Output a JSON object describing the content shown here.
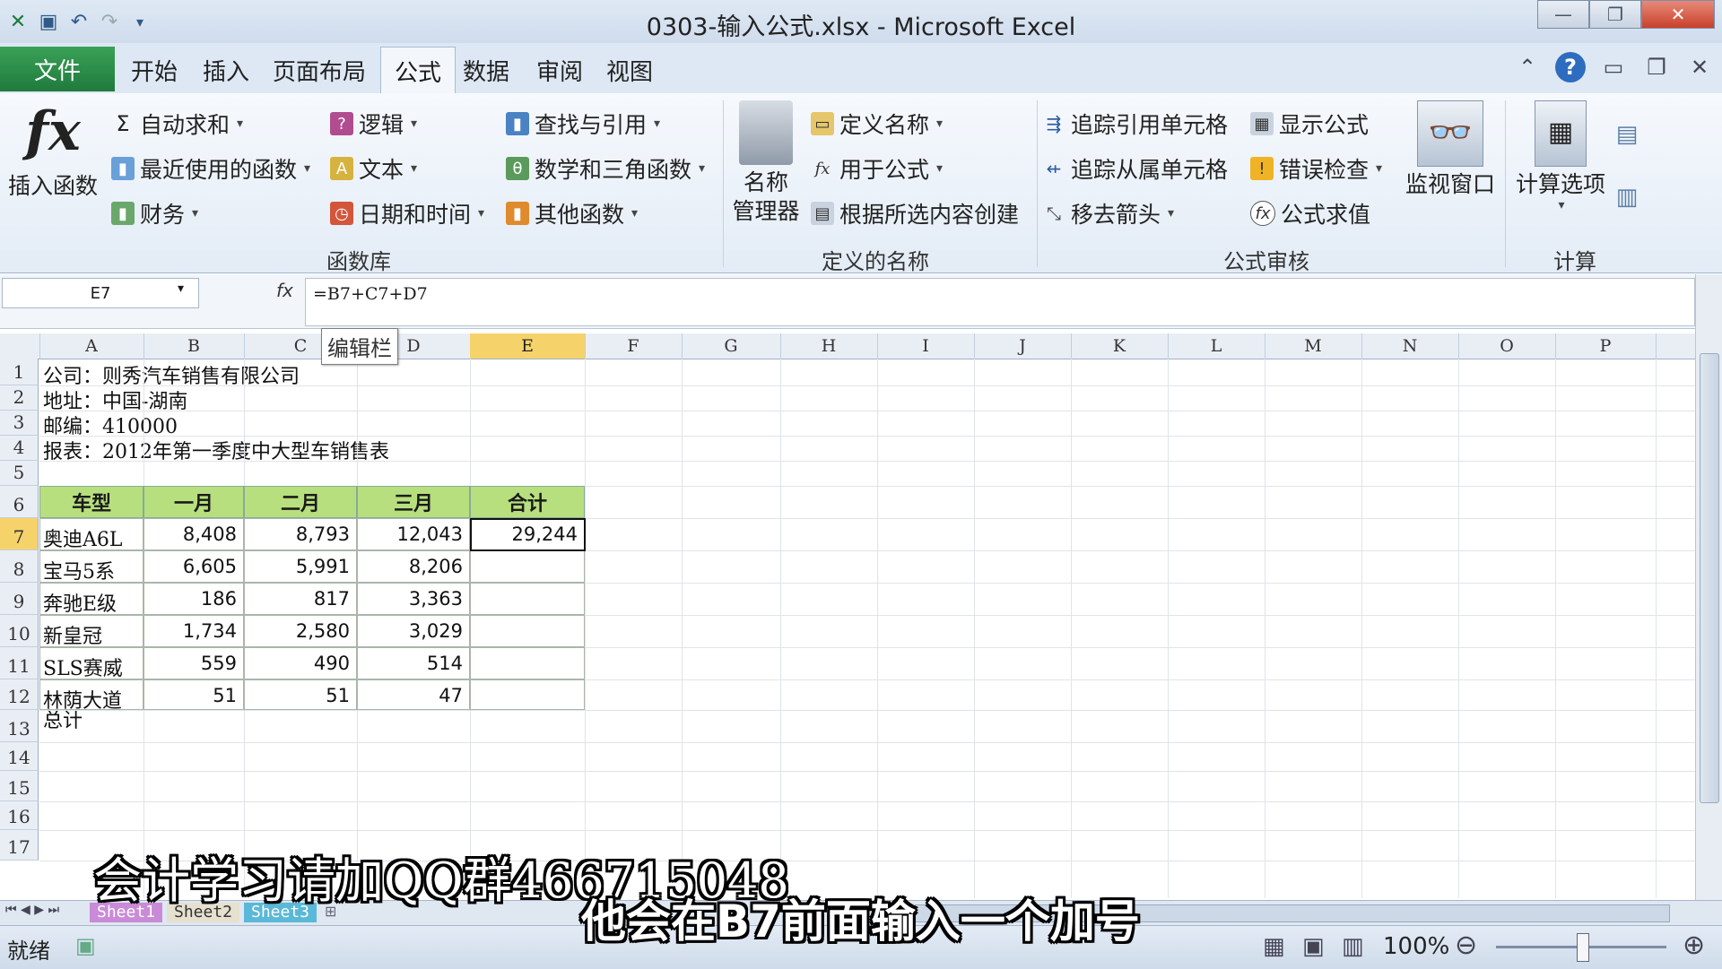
{
  "window": {
    "title": "0303-输入公式.xlsx - Microsoft Excel"
  },
  "tabs": [
    "开始",
    "插入",
    "页面布局",
    "数据",
    "审阅",
    "视图"
  ],
  "tab_file": "文件",
  "tab_active": "公式",
  "ribbon": {
    "insert_function": "插入函数",
    "autosum": "自动求和",
    "recent": "最近使用的函数",
    "finance": "财务",
    "logic": "逻辑",
    "text": "文本",
    "datetime": "日期和时间",
    "lookup": "查找与引用",
    "math": "数学和三角函数",
    "other": "其他函数",
    "group_library": "函数库",
    "name_manager_1": "名称",
    "name_manager_2": "管理器",
    "define_name": "定义名称",
    "use_in_formula": "用于公式",
    "create_from_sel": "根据所选内容创建",
    "group_names": "定义的名称",
    "trace_precedents": "追踪引用单元格",
    "trace_dependents": "追踪从属单元格",
    "remove_arrows": "移去箭头",
    "show_formulas": "显示公式",
    "error_check": "错误检查",
    "evaluate": "公式求值",
    "group_audit": "公式审核",
    "watch_window": "监视窗口",
    "calc_options": "计算选项",
    "group_calc": "计算"
  },
  "formula_bar": {
    "name_box": "E7",
    "formula": "=B7+C7+D7",
    "tooltip": "编辑栏"
  },
  "columns": [
    "A",
    "B",
    "C",
    "D",
    "E",
    "F",
    "G",
    "H",
    "I",
    "J",
    "K",
    "L",
    "M",
    "N",
    "O",
    "P"
  ],
  "rows": [
    "1",
    "2",
    "3",
    "4",
    "5",
    "6",
    "7",
    "8",
    "9",
    "10",
    "11",
    "12",
    "13",
    "14",
    "15",
    "16",
    "17"
  ],
  "info": {
    "company": "公司：则秀汽车销售有限公司",
    "address": "地址：中国-湖南",
    "zip": "邮编：410000",
    "report": "报表：2012年第一季度中大型车销售表",
    "total": "总计"
  },
  "table": {
    "headers": [
      "车型",
      "一月",
      "二月",
      "三月",
      "合计"
    ],
    "rows": [
      [
        "奥迪A6L",
        "8,408",
        "8,793",
        "12,043",
        "29,244"
      ],
      [
        "宝马5系",
        "6,605",
        "5,991",
        "8,206",
        ""
      ],
      [
        "奔驰E级",
        "186",
        "817",
        "3,363",
        ""
      ],
      [
        "新皇冠",
        "1,734",
        "2,580",
        "3,029",
        ""
      ],
      [
        "SLS赛威",
        "559",
        "490",
        "514",
        ""
      ],
      [
        "林荫大道",
        "51",
        "51",
        "47",
        ""
      ]
    ]
  },
  "sheets": [
    "Sheet1",
    "Sheet2",
    "Sheet3"
  ],
  "status": {
    "ready": "就绪",
    "zoom": "100%"
  },
  "captions": {
    "top": "会计学习请加QQ群466715048",
    "bottom": "他会在B7前面输入一个加号"
  }
}
